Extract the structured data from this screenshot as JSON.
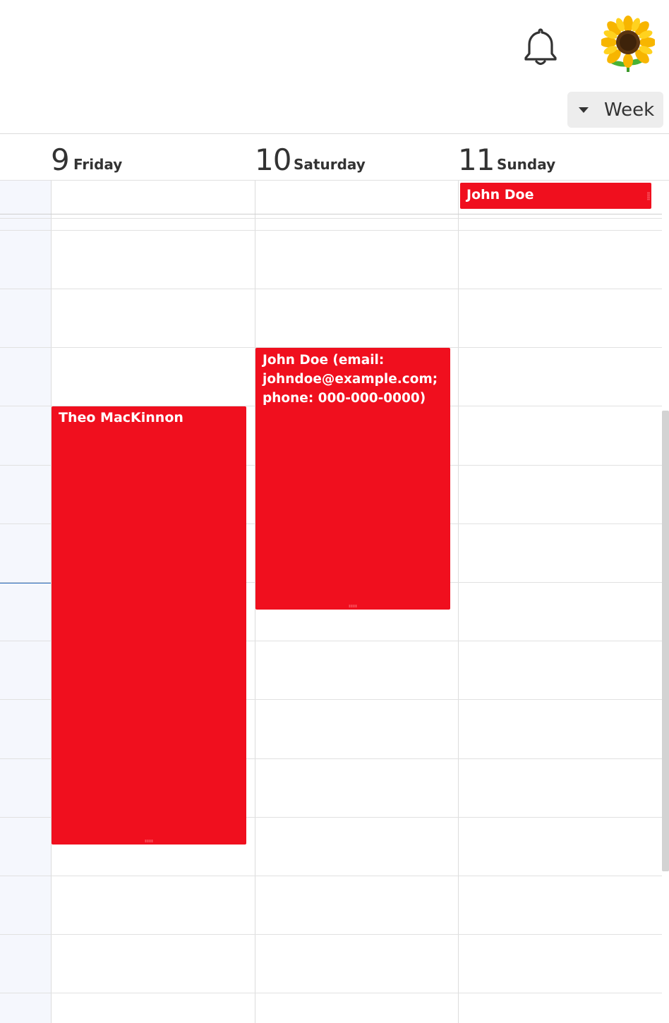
{
  "header": {
    "notifications_icon": "bell-icon",
    "avatar_icon": "sunflower-icon",
    "view_selector": {
      "label": "Week",
      "icon": "caret-down-icon"
    }
  },
  "days": [
    {
      "number": "9",
      "name": "Friday"
    },
    {
      "number": "10",
      "name": "Saturday"
    },
    {
      "number": "11",
      "name": "Sunday"
    }
  ],
  "allday_events": [
    {
      "title": "John Doe",
      "day": "Sunday",
      "color": "#f00f1e"
    }
  ],
  "events": [
    {
      "title": "Theo MacKinnon",
      "day": "Friday",
      "color": "#f00f1e"
    },
    {
      "title": "John Doe (email: johndoe@example.com; phone: 000-000-0000)",
      "day": "Saturday",
      "color": "#f00f1e"
    }
  ],
  "colors": {
    "event": "#f00f1e",
    "now_indicator": "#1f62b7",
    "gutter": "#f5f7fd"
  }
}
